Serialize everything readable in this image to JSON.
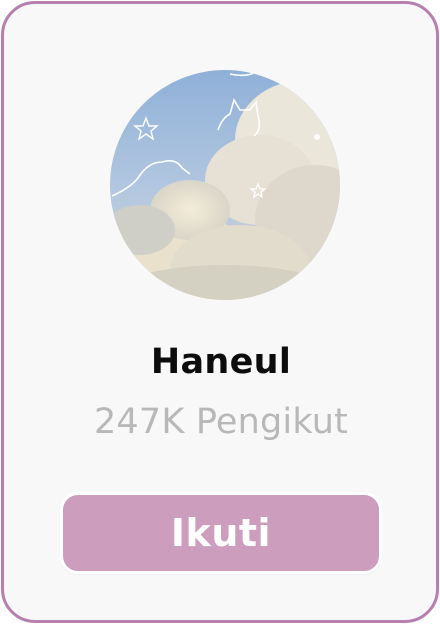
{
  "profile": {
    "name": "Haneul",
    "followers": "247K Pengikut",
    "avatar_icon": "sky-clouds-avatar"
  },
  "actions": {
    "follow_label": "Ikuti"
  },
  "colors": {
    "card_border": "#b67fb0",
    "card_background": "#f8f8f8",
    "button_background": "#cc9dbc",
    "name_text": "#0c0c0c",
    "followers_text": "#b8b8b8"
  }
}
